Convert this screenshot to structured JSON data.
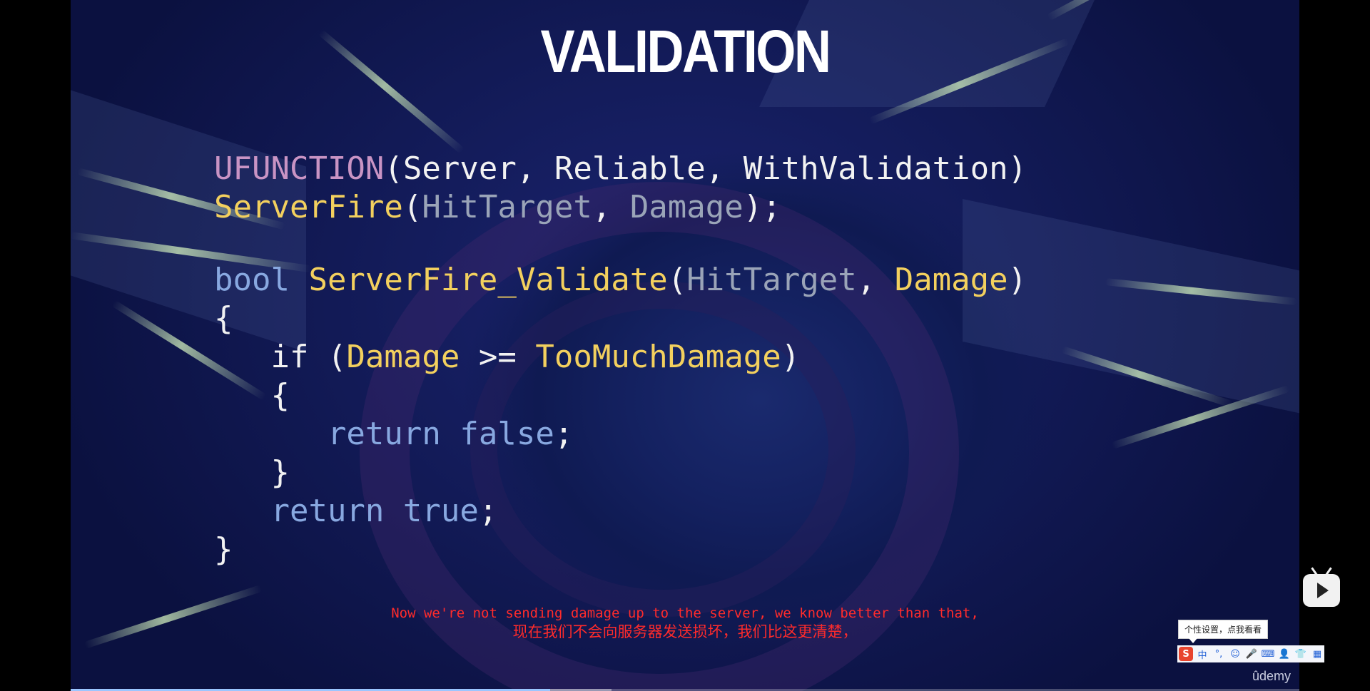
{
  "slide": {
    "title": "VALIDATION",
    "code": [
      [
        {
          "t": "UFUNCTION",
          "c": "macro"
        },
        {
          "t": "(Server, Reliable, WithValidation)",
          "c": "plain"
        }
      ],
      [
        {
          "t": "ServerFire",
          "c": "func"
        },
        {
          "t": "(",
          "c": "plain"
        },
        {
          "t": "HitTarget",
          "c": "param"
        },
        {
          "t": ", ",
          "c": "plain"
        },
        {
          "t": "Damage",
          "c": "param"
        },
        {
          "t": ");",
          "c": "plain"
        }
      ],
      [],
      [
        {
          "t": "bool ",
          "c": "kw"
        },
        {
          "t": "ServerFire_Validate",
          "c": "func"
        },
        {
          "t": "(",
          "c": "plain"
        },
        {
          "t": "HitTarget",
          "c": "param"
        },
        {
          "t": ", ",
          "c": "plain"
        },
        {
          "t": "Damage",
          "c": "func"
        },
        {
          "t": ")",
          "c": "plain"
        }
      ],
      [
        {
          "t": "{",
          "c": "plain"
        }
      ],
      [
        {
          "t": "   if (",
          "c": "plain"
        },
        {
          "t": "Damage",
          "c": "func"
        },
        {
          "t": " >= ",
          "c": "plain"
        },
        {
          "t": "TooMuchDamage",
          "c": "func"
        },
        {
          "t": ")",
          "c": "plain"
        }
      ],
      [
        {
          "t": "   {",
          "c": "plain"
        }
      ],
      [
        {
          "t": "      return false",
          "c": "kw"
        },
        {
          "t": ";",
          "c": "plain"
        }
      ],
      [
        {
          "t": "   }",
          "c": "plain"
        }
      ],
      [
        {
          "t": "   return true",
          "c": "kw"
        },
        {
          "t": ";",
          "c": "plain"
        }
      ],
      [
        {
          "t": "}",
          "c": "plain"
        }
      ]
    ]
  },
  "subtitles": {
    "english": "Now we're not sending damage up to the server, we know better than that,",
    "chinese": "现在我们不会向服务器发送损坏，我们比这更清楚，"
  },
  "watermark": "ûdemy",
  "ime": {
    "tooltip": "个性设置，点我看看",
    "buttons": [
      "S",
      "中",
      "°,",
      "☺",
      "🎤",
      "⌨",
      "👤",
      "👕",
      "▦"
    ]
  },
  "player": {
    "icon": "bilibili-tv-icon",
    "progress_fraction": 0.39,
    "buffer_fraction": 0.44
  },
  "colors": {
    "macro": "#c994c4",
    "function": "#f3d05e",
    "parameter": "#9aa4b8",
    "keyword": "#88a8e0",
    "subtitle": "#ff2b2b"
  }
}
